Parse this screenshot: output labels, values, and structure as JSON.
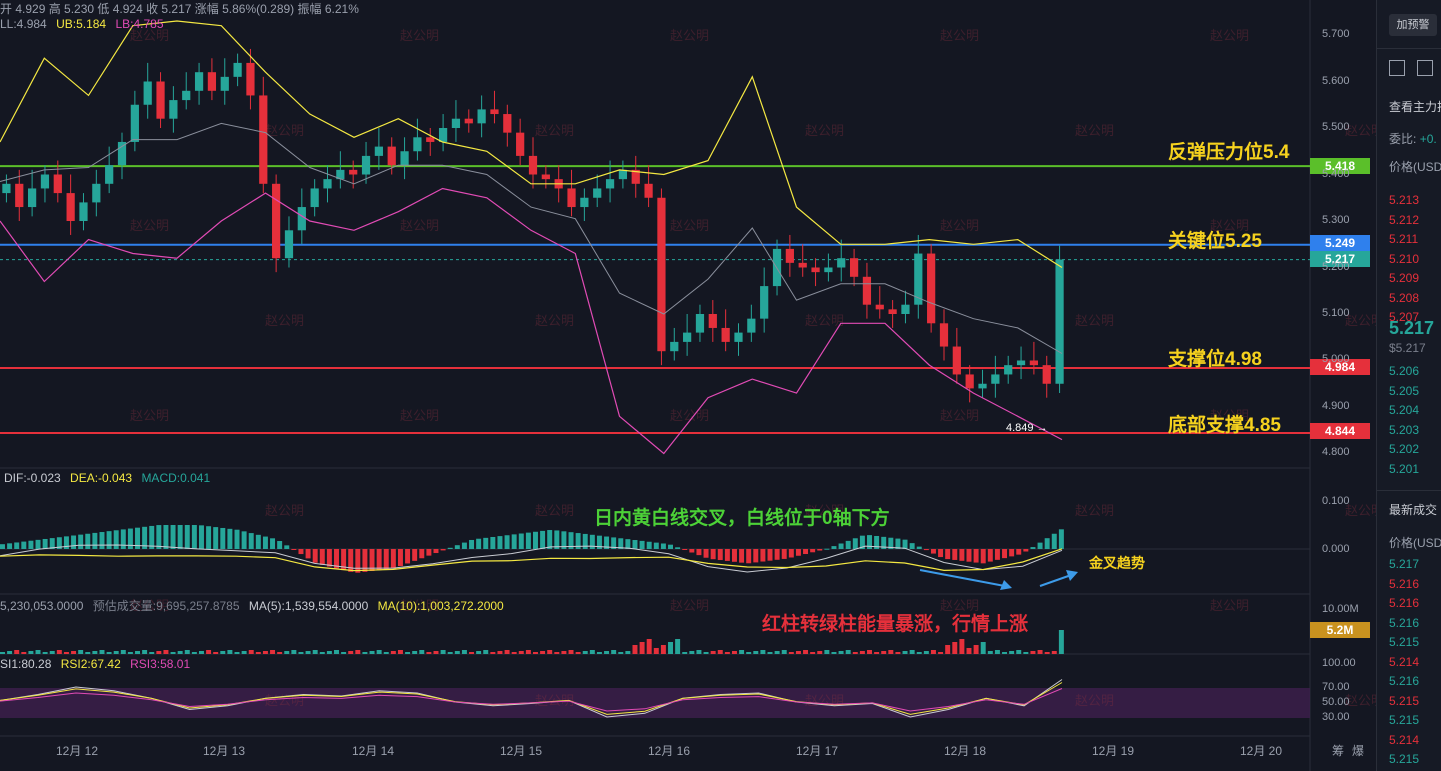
{
  "header": {
    "ohlc": "开 4.929  高 5.230  低 4.924  收 5.217  涨幅 5.86%(0.289)  振幅 6.21%",
    "boll": {
      "mid": "LL:4.984",
      "ub": "UB:5.184",
      "lb": "LB:4.785"
    }
  },
  "annotations": {
    "resistance": "反弹压力位5.4",
    "key": "关键位5.25",
    "support": "支撑位4.98",
    "bottom": "底部支撑4.85",
    "macd_note": "日内黄白线交叉，白线位于0轴下方",
    "golden_cross": "金叉趋势",
    "volume_note": "红柱转绿柱能量暴涨，行情上涨",
    "low_label": "4.849 →"
  },
  "price_levels": [
    {
      "name": "resistance",
      "value": "5.418",
      "color": "#5bbf2a"
    },
    {
      "name": "key",
      "value": "5.249",
      "color": "#2f80ed"
    },
    {
      "name": "current",
      "value": "5.217",
      "color": "#26a69a"
    },
    {
      "name": "support",
      "value": "4.984",
      "color": "#e5303b"
    },
    {
      "name": "bottom",
      "value": "4.844",
      "color": "#e5303b"
    }
  ],
  "price_ticks": [
    "5.700",
    "5.600",
    "5.500",
    "5.400",
    "5.300",
    "5.200",
    "5.100",
    "5.000",
    "4.900",
    "4.800"
  ],
  "macd": {
    "dif": "DIF:-0.023",
    "dea": "DEA:-0.043",
    "macd": "MACD:0.041",
    "ticks": [
      "0.100",
      "0.000"
    ]
  },
  "volume": {
    "vol": "5,230,053.0000",
    "est": "预估成交量:9,695,257.8785",
    "ma5": "MA(5):1,539,554.0000",
    "ma10": "MA(10):1,003,272.2000",
    "tick": "10.00M",
    "tag": "5.2M"
  },
  "rsi": {
    "rsi1": "SI1:80.28",
    "rsi2": "RSI2:67.42",
    "rsi3": "RSI3:58.01",
    "ticks": [
      "100.00",
      "70.00",
      "50.00",
      "30.00"
    ]
  },
  "x_ticks": [
    "12月 12",
    "12月 13",
    "12月 14",
    "12月 15",
    "12月 16",
    "12月 17",
    "12月 18",
    "12月 19",
    "12月 20"
  ],
  "footer_icons": [
    "筹",
    "爆"
  ],
  "watermark": "赵公明",
  "right_panel": {
    "alert_button": "加预警",
    "view_main": "查看主力挂",
    "ratio_label": "委比:",
    "ratio_value": "+0.",
    "price_header": "价格(USD",
    "asks": [
      "5.213",
      "5.212",
      "5.211",
      "5.210",
      "5.209",
      "5.208",
      "5.207"
    ],
    "last_price": "5.217",
    "last_usd": "$5.217",
    "bids": [
      "5.206",
      "5.205",
      "5.204",
      "5.203",
      "5.202",
      "5.201"
    ],
    "trades_title": "最新成交",
    "trades_header": "价格(USD",
    "trades": [
      {
        "p": "5.217",
        "c": "#26a69a"
      },
      {
        "p": "5.216",
        "c": "#e5303b"
      },
      {
        "p": "5.216",
        "c": "#e5303b"
      },
      {
        "p": "5.216",
        "c": "#26a69a"
      },
      {
        "p": "5.215",
        "c": "#26a69a"
      },
      {
        "p": "5.214",
        "c": "#e5303b"
      },
      {
        "p": "5.216",
        "c": "#26a69a"
      },
      {
        "p": "5.215",
        "c": "#e5303b"
      },
      {
        "p": "5.215",
        "c": "#26a69a"
      },
      {
        "p": "5.214",
        "c": "#e5303b"
      },
      {
        "p": "5.215",
        "c": "#26a69a"
      }
    ]
  },
  "chart_data": {
    "type": "candlestick",
    "x_range": [
      "12月 11",
      "12月 19"
    ],
    "ylim": [
      4.76,
      5.76
    ],
    "series": [
      {
        "name": "price",
        "values": [
          5.38,
          5.33,
          5.37,
          5.4,
          5.36,
          5.3,
          5.34,
          5.38,
          5.42,
          5.47,
          5.55,
          5.6,
          5.52,
          5.56,
          5.58,
          5.62,
          5.58,
          5.61,
          5.64,
          5.57,
          5.38,
          5.22,
          5.28,
          5.33,
          5.37,
          5.39,
          5.41,
          5.4,
          5.44,
          5.46,
          5.42,
          5.45,
          5.48,
          5.47,
          5.5,
          5.52,
          5.51,
          5.54,
          5.53,
          5.49,
          5.44,
          5.4,
          5.39,
          5.37,
          5.33,
          5.35,
          5.37,
          5.39,
          5.41,
          5.38,
          5.35,
          5.02,
          5.04,
          5.06,
          5.1,
          5.07,
          5.04,
          5.06,
          5.09,
          5.16,
          5.24,
          5.21,
          5.2,
          5.19,
          5.2,
          5.22,
          5.18,
          5.12,
          5.11,
          5.1,
          5.12,
          5.23,
          5.08,
          5.03,
          4.97,
          4.94,
          4.95,
          4.97,
          4.99,
          5.0,
          4.99,
          4.95,
          5.217
        ]
      },
      {
        "name": "UB",
        "values": [
          5.47,
          5.65,
          5.57,
          5.72,
          5.73,
          5.72,
          5.62,
          5.53,
          5.48,
          5.52,
          5.47,
          5.45,
          5.38,
          5.38,
          5.41,
          5.4,
          5.43,
          5.61,
          5.33,
          5.25,
          5.25,
          5.26,
          5.25,
          5.26,
          5.2
        ]
      },
      {
        "name": "LB",
        "values": [
          5.3,
          5.17,
          5.26,
          5.23,
          5.22,
          5.3,
          5.36,
          5.3,
          5.28,
          5.32,
          5.37,
          5.35,
          5.28,
          5.23,
          4.88,
          4.8,
          4.92,
          4.96,
          4.93,
          5.08,
          5.08,
          4.99,
          4.93,
          4.88,
          4.83
        ]
      },
      {
        "name": "MACD",
        "values": [
          0.01,
          0.02,
          0.03,
          0.04,
          0.05,
          0.05,
          0.04,
          0.02,
          -0.03,
          -0.05,
          -0.04,
          -0.01,
          0.02,
          0.03,
          0.04,
          0.03,
          0.02,
          0.01,
          -0.02,
          -0.03,
          -0.02,
          0.0,
          0.03,
          0.02,
          -0.02,
          -0.03,
          -0.01,
          0.041
        ]
      },
      {
        "name": "RSI",
        "values": [
          52,
          60,
          70,
          65,
          55,
          40,
          45,
          55,
          60,
          58,
          65,
          62,
          50,
          45,
          48,
          52,
          30,
          35,
          55,
          60,
          62,
          50,
          45,
          48,
          30,
          40,
          55,
          45,
          80
        ]
      }
    ]
  }
}
